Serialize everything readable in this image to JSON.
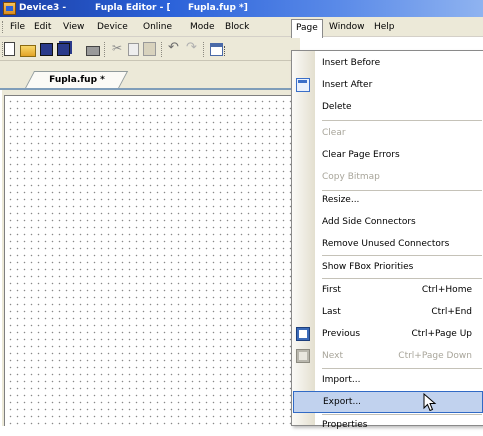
{
  "titlebar": {
    "part1": "Device3 -",
    "part2": "Fupla Editor - [",
    "part3": "Fupla.fup *]"
  },
  "menubar": {
    "items": [
      "File",
      "Edit",
      "View",
      "Device",
      "Online",
      "Mode",
      "Block",
      "Page",
      "Window",
      "Help"
    ],
    "active": "Page"
  },
  "toolbar": {
    "icons": [
      "new-icon",
      "open-icon",
      "save-icon",
      "save-all-icon",
      "print-icon",
      "cut-icon",
      "copy-icon",
      "paste-icon",
      "undo-icon",
      "redo-icon",
      "calendar-icon"
    ]
  },
  "document_tab": {
    "label": "Fupla.fup *"
  },
  "page_menu": {
    "items": [
      {
        "label": "Insert Before",
        "shortcut": "",
        "enabled": true
      },
      {
        "label": "Insert After",
        "shortcut": "",
        "enabled": true,
        "icon": "insert-after-icon"
      },
      {
        "label": "Delete",
        "shortcut": "",
        "enabled": true
      },
      {
        "label": "Clear",
        "shortcut": "",
        "enabled": false
      },
      {
        "label": "Clear Page Errors",
        "shortcut": "",
        "enabled": true
      },
      {
        "label": "Copy Bitmap",
        "shortcut": "",
        "enabled": false
      },
      {
        "label": "Resize...",
        "shortcut": "",
        "enabled": true
      },
      {
        "label": "Add Side Connectors",
        "shortcut": "",
        "enabled": true
      },
      {
        "label": "Remove Unused Connectors",
        "shortcut": "",
        "enabled": true
      },
      {
        "label": "Show FBox Priorities",
        "shortcut": "",
        "enabled": true
      },
      {
        "label": "First",
        "shortcut": "Ctrl+Home",
        "enabled": true
      },
      {
        "label": "Last",
        "shortcut": "Ctrl+End",
        "enabled": true
      },
      {
        "label": "Previous",
        "shortcut": "Ctrl+Page Up",
        "enabled": true,
        "icon": "previous-page-icon"
      },
      {
        "label": "Next",
        "shortcut": "Ctrl+Page Down",
        "enabled": false,
        "icon": "next-page-icon"
      },
      {
        "label": "Import...",
        "shortcut": "",
        "enabled": true
      },
      {
        "label": "Export...",
        "shortcut": "",
        "enabled": true,
        "highlighted": true
      },
      {
        "label": "Properties",
        "shortcut": "",
        "enabled": true
      }
    ]
  },
  "colors": {
    "titlebar_start": "#1b3fa6",
    "menu_bg": "#ece9d8",
    "highlight": "#c1d2ee",
    "highlight_border": "#316ac5",
    "disabled_text": "#a8a59a"
  }
}
